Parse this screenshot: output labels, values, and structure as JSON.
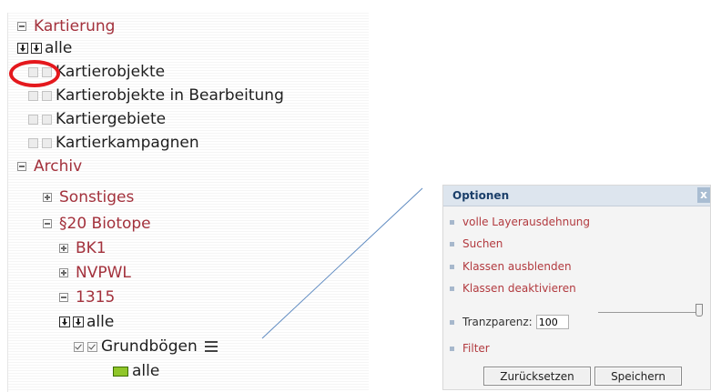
{
  "tree": {
    "kartierung": "Kartierung",
    "alle": "alle",
    "kartierobjekte": "Kartierobjekte",
    "kartierobjekte_bearbeitung": "Kartierobjekte in Bearbeitung",
    "kartiergebiete": "Kartiergebiete",
    "kartierkampagnen": "Kartierkampagnen",
    "archiv": "Archiv",
    "sonstiges": "Sonstiges",
    "biotope": "§20 Biotope",
    "bk1": "BK1",
    "nvpwl": "NVPWL",
    "n1315": "1315",
    "grundboegen": "Grundbögen",
    "legend_alle": "alle"
  },
  "colors": {
    "group_label": "#a3313c",
    "highlight_circle": "#e4181d",
    "legend_swatch": "#8fc629",
    "option_link": "#b23a3f"
  },
  "options_panel": {
    "title": "Optionen",
    "close": "x",
    "items": [
      "volle Layerausdehnung",
      "Suchen",
      "Klassen ausblenden",
      "Klassen deaktivieren"
    ],
    "transparency_label": "Tranzparenz:",
    "transparency_value": "100",
    "filter": "Filter",
    "reset_button": "Zurücksetzen",
    "save_button": "Speichern"
  }
}
